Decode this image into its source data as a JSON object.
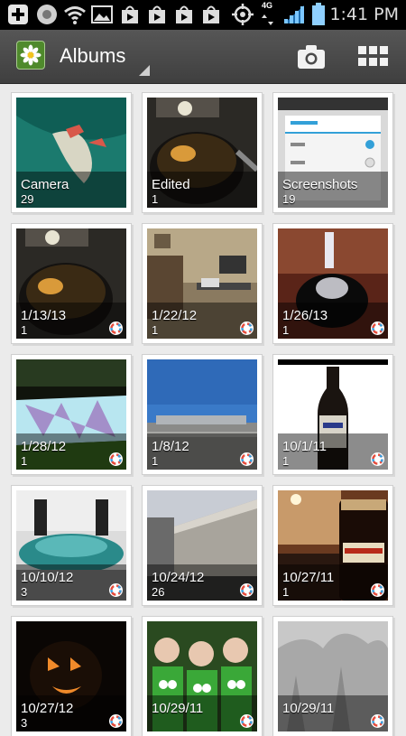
{
  "status_bar": {
    "network": "4G",
    "time": "1:41 PM"
  },
  "action_bar": {
    "title": "Albums",
    "camera_icon": "camera-icon",
    "view_icon": "grid-view-icon"
  },
  "albums": [
    {
      "name": "Camera",
      "count": "29",
      "synced": false
    },
    {
      "name": "Edited",
      "count": "1",
      "synced": false
    },
    {
      "name": "Screenshots",
      "count": "19",
      "synced": false
    },
    {
      "name": "1/13/13",
      "count": "1",
      "synced": true
    },
    {
      "name": "1/22/12",
      "count": "1",
      "synced": true
    },
    {
      "name": "1/26/13",
      "count": "1",
      "synced": true
    },
    {
      "name": "1/28/12",
      "count": "1",
      "synced": true
    },
    {
      "name": "1/8/12",
      "count": "1",
      "synced": true
    },
    {
      "name": "10/1/11",
      "count": "1",
      "synced": true
    },
    {
      "name": "10/10/12",
      "count": "3",
      "synced": true
    },
    {
      "name": "10/24/12",
      "count": "26",
      "synced": true
    },
    {
      "name": "10/27/11",
      "count": "1",
      "synced": true
    },
    {
      "name": "10/27/12",
      "count": "3",
      "synced": true
    },
    {
      "name": "10/29/11",
      "count": "",
      "synced": true
    },
    {
      "name": "10/29/11",
      "count": "",
      "synced": true
    }
  ]
}
